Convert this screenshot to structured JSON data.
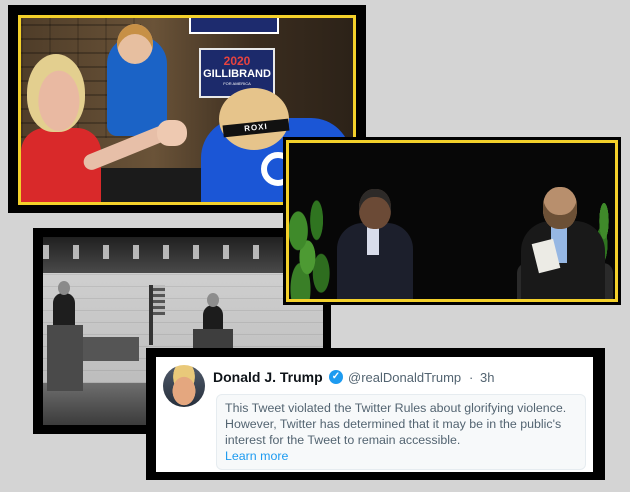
{
  "panel_arm_wrestling": {
    "sign_year": "2020",
    "sign_name": "GILLIBRAND",
    "sign_sub": "FOR AMERICA",
    "headband_text": "ROXI"
  },
  "tweet": {
    "display_name": "Donald J. Trump",
    "handle": "@realDonaldTrump",
    "separator": "·",
    "time": "3h",
    "verified_icon": "✓",
    "notice_text": "This Tweet violated the Twitter Rules about glorifying violence. However, Twitter has determined that it may be in the public's interest for the Tweet to remain accessible.",
    "learn_more": "Learn more"
  },
  "colors": {
    "background": "#d4d4d4",
    "frame": "#000000",
    "highlight_border": "#f3d02a",
    "twitter_blue": "#1d9bf0"
  }
}
